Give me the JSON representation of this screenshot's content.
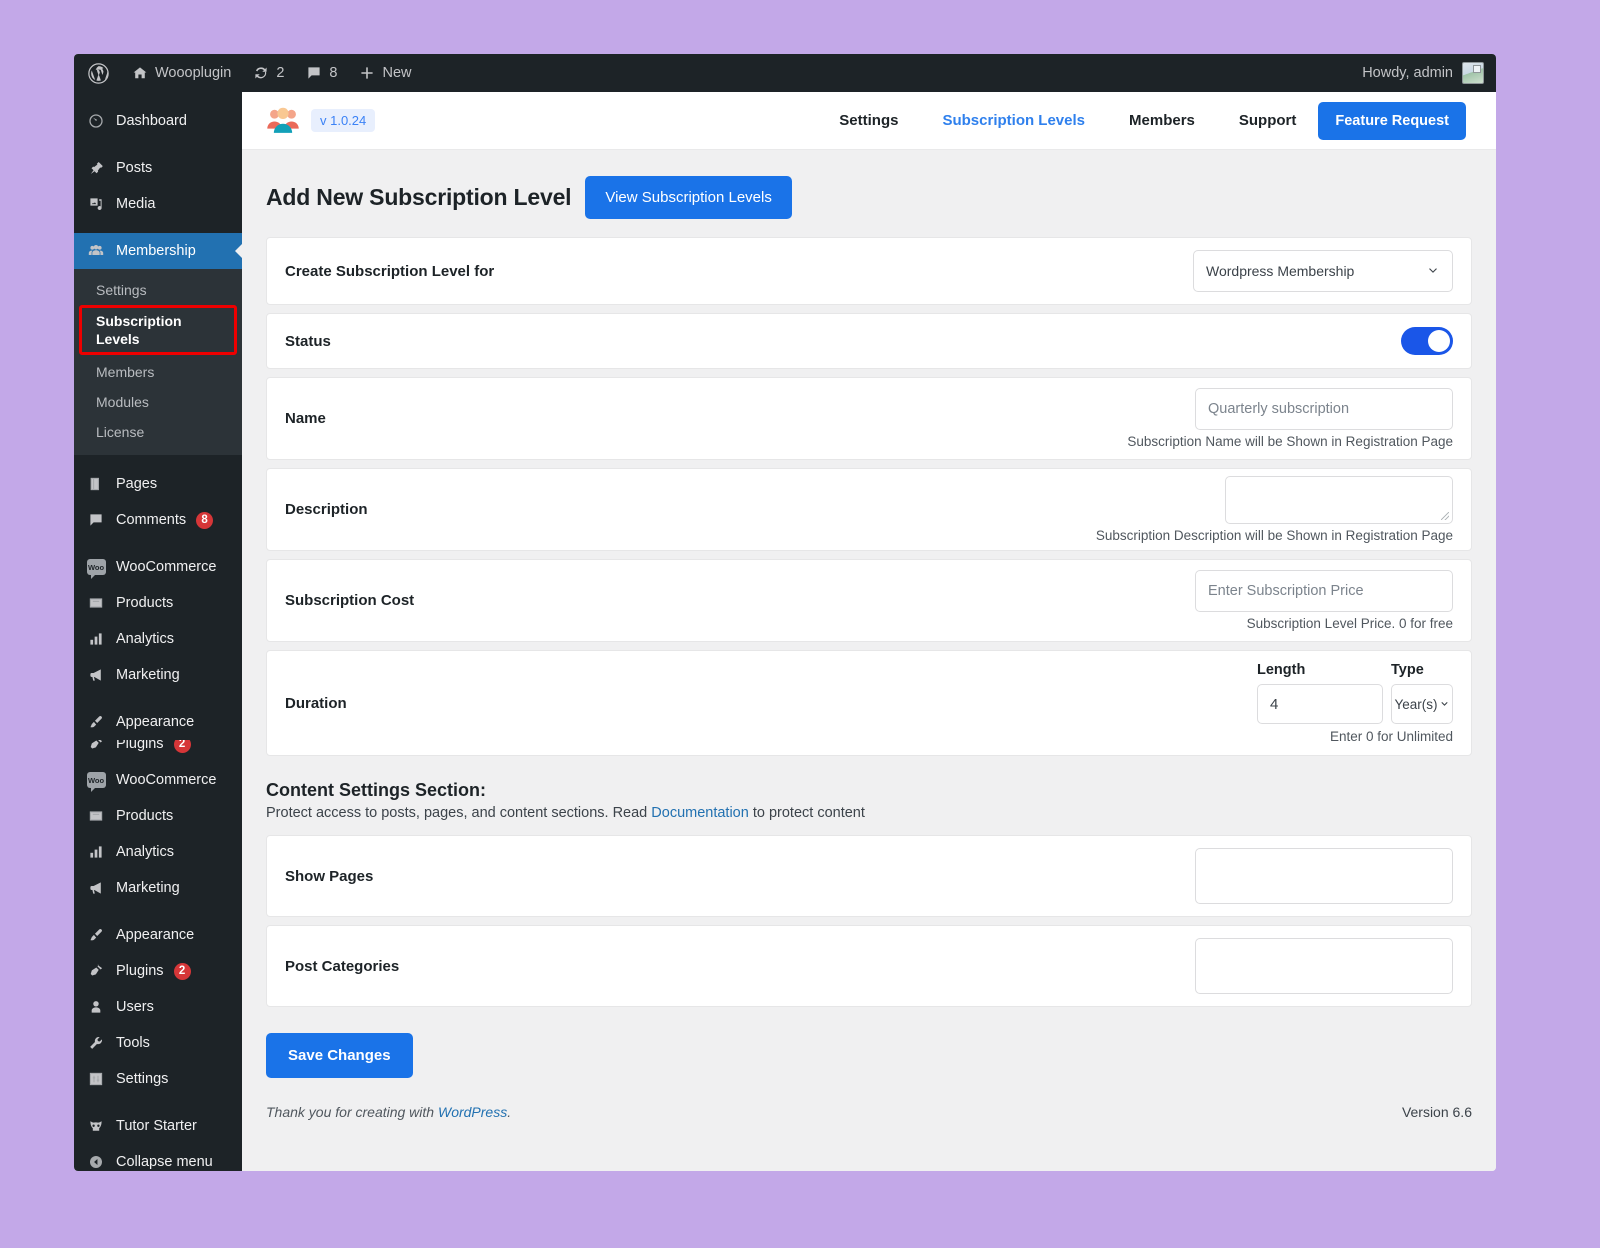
{
  "adminbar": {
    "site_name": "Woooplugin",
    "updates_count": "2",
    "comments_count": "8",
    "new_label": "New",
    "howdy": "Howdy, admin"
  },
  "sidebar": {
    "items": [
      {
        "label": "Dashboard",
        "icon": "dashboard-icon"
      },
      {
        "label": "Posts",
        "icon": "pin-icon"
      },
      {
        "label": "Media",
        "icon": "media-icon"
      },
      {
        "label": "Membership",
        "icon": "users-group-icon",
        "current": true
      },
      {
        "label": "Pages",
        "icon": "pages-icon"
      },
      {
        "label": "Comments",
        "icon": "comment-icon",
        "badge": "8"
      },
      {
        "label": "WooCommerce",
        "icon": "woo-icon"
      },
      {
        "label": "Products",
        "icon": "products-icon"
      },
      {
        "label": "Analytics",
        "icon": "analytics-icon"
      },
      {
        "label": "Marketing",
        "icon": "megaphone-icon"
      },
      {
        "label": "Appearance",
        "icon": "brush-icon"
      },
      {
        "label": "Plugins",
        "icon": "plug-icon",
        "badge": "2"
      },
      {
        "label": "Users",
        "icon": "user-icon"
      },
      {
        "label": "Tools",
        "icon": "wrench-icon"
      },
      {
        "label": "Settings",
        "icon": "sliders-icon"
      },
      {
        "label": "Tutor Starter",
        "icon": "owl-icon"
      },
      {
        "label": "Collapse menu",
        "icon": "collapse-icon"
      }
    ],
    "membership_submenu": [
      {
        "label": "Settings"
      },
      {
        "label": "Subscription Levels",
        "active": true,
        "highlighted": true
      },
      {
        "label": "Members"
      },
      {
        "label": "Modules"
      },
      {
        "label": "License"
      }
    ],
    "duplicated_group": [
      {
        "label": "WooCommerce",
        "icon": "woo-icon"
      },
      {
        "label": "Products",
        "icon": "products-icon"
      },
      {
        "label": "Analytics",
        "icon": "analytics-icon"
      },
      {
        "label": "Marketing",
        "icon": "megaphone-icon"
      },
      {
        "label": "Appearance",
        "icon": "brush-icon"
      }
    ]
  },
  "plugin_header": {
    "version_label": "v 1.0.24",
    "nav": [
      {
        "label": "Settings",
        "active": false
      },
      {
        "label": "Subscription Levels",
        "active": true
      },
      {
        "label": "Members",
        "active": false
      },
      {
        "label": "Support",
        "active": false
      }
    ],
    "cta_label": "Feature Request"
  },
  "page": {
    "title": "Add New Subscription Level",
    "view_button": "View Subscription Levels"
  },
  "form": {
    "create_for": {
      "label": "Create Subscription Level for",
      "selected": "Wordpress Membership"
    },
    "status": {
      "label": "Status",
      "enabled": true
    },
    "name": {
      "label": "Name",
      "placeholder": "Quarterly subscription",
      "hint": "Subscription Name will be Shown in Registration Page"
    },
    "description": {
      "label": "Description",
      "value": "",
      "hint": "Subscription Description will be Shown in Registration Page"
    },
    "cost": {
      "label": "Subscription Cost",
      "placeholder": "Enter Subscription Price",
      "hint": "Subscription Level Price. 0 for free"
    },
    "duration": {
      "label": "Duration",
      "length_header": "Length",
      "type_header": "Type",
      "length_value": "4",
      "type_value": "Year(s)",
      "hint": "Enter 0 for Unlimited"
    }
  },
  "content_settings": {
    "title": "Content Settings Section:",
    "desc_before": "Protect access to posts, pages, and content sections. Read ",
    "desc_link": "Documentation",
    "desc_after": " to protect content",
    "show_pages_label": "Show Pages",
    "post_categories_label": "Post Categories"
  },
  "actions": {
    "save_label": "Save Changes"
  },
  "footer": {
    "thanks_before": "Thank you for creating with ",
    "thanks_link": "WordPress",
    "thanks_after": ".",
    "version": "Version 6.6"
  },
  "colors": {
    "accent_blue": "#1a73e8",
    "link_blue": "#2271b1",
    "admin_dark": "#1d2327",
    "current_blue": "#2271b1",
    "highlight_red": "#ee0000",
    "page_bg": "#c3a8e8"
  }
}
